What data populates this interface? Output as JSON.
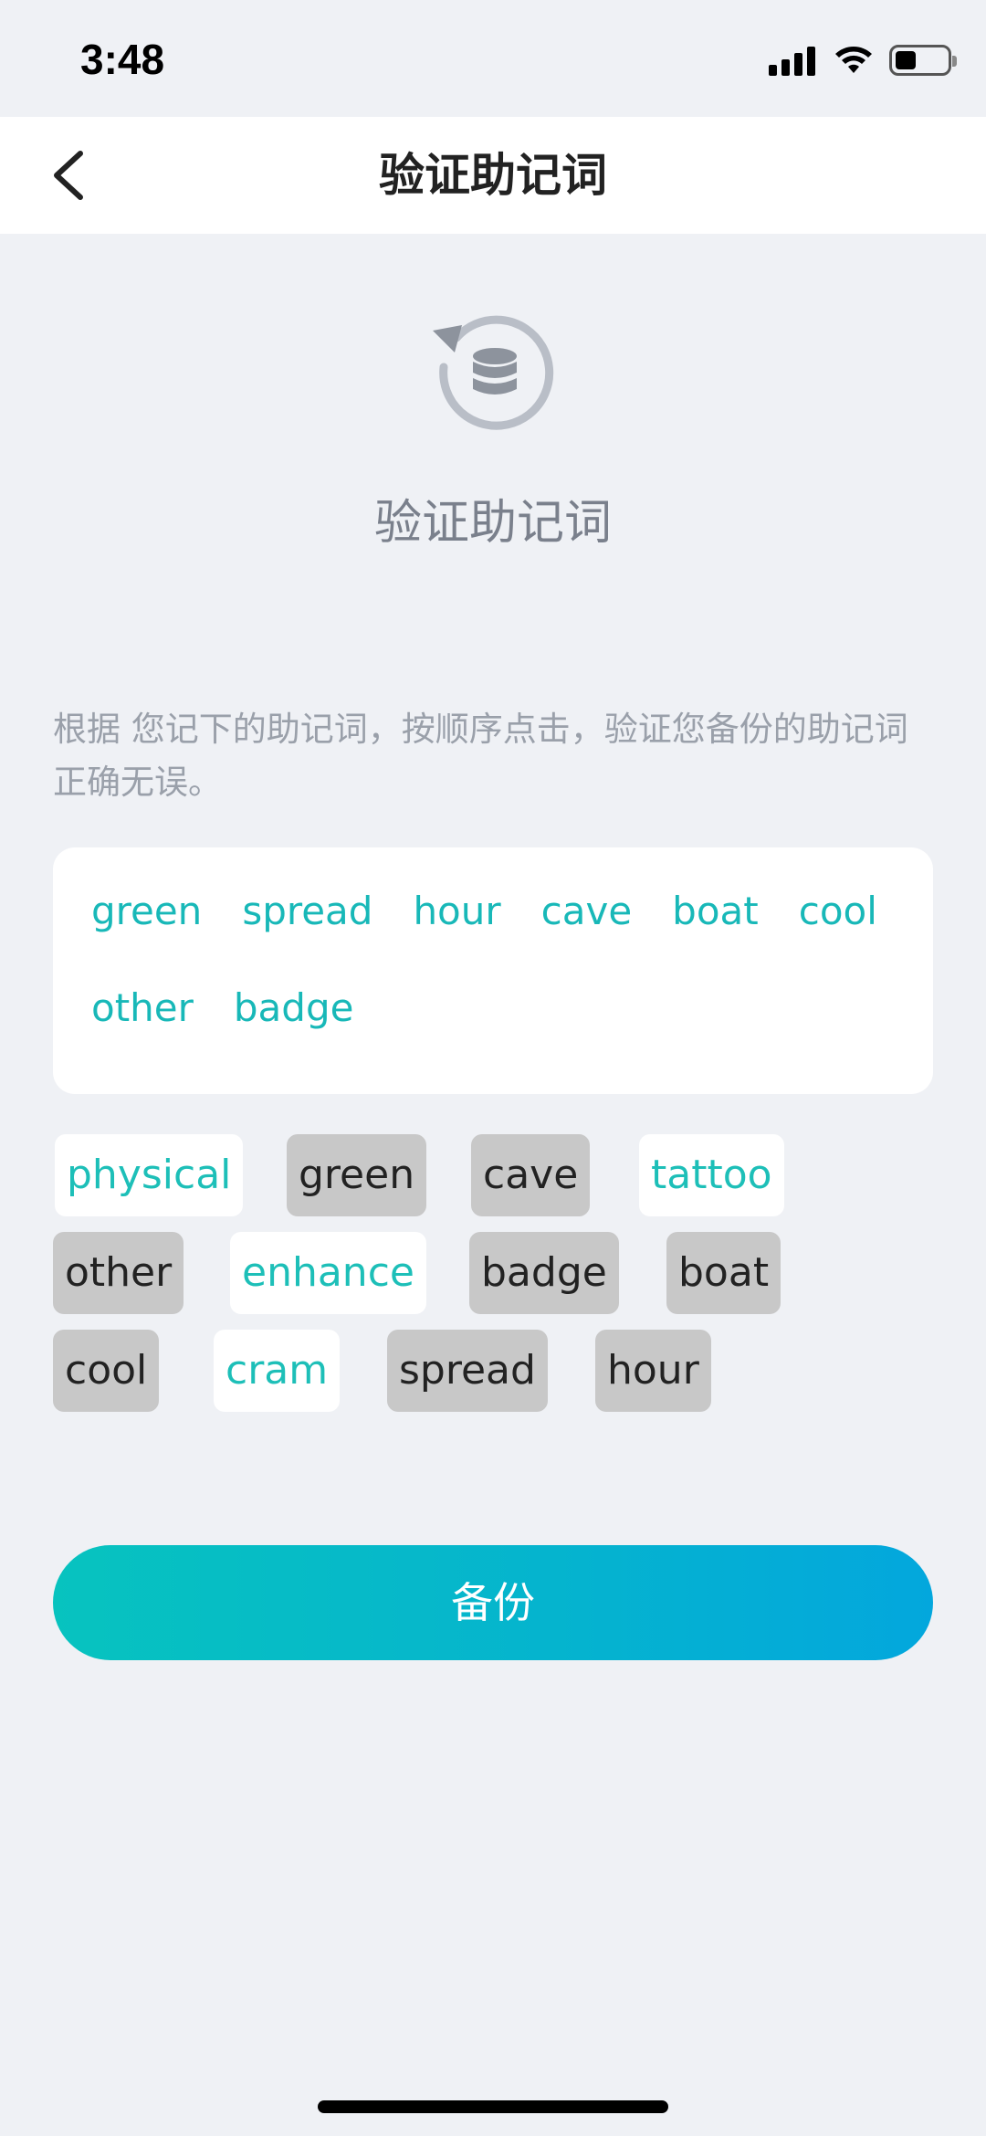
{
  "status_bar": {
    "time": "3:48"
  },
  "header": {
    "title": "验证助记词"
  },
  "hero": {
    "title": "验证助记词"
  },
  "instructions": "根据 您记下的助记词，按顺序点击，验证您备份的助记词正确无误。",
  "selected_words": [
    "green",
    "spread",
    "hour",
    "cave",
    "boat",
    "cool",
    "other",
    "badge"
  ],
  "word_pool": [
    {
      "word": "physical",
      "state": "available"
    },
    {
      "word": "green",
      "state": "selected"
    },
    {
      "word": "cave",
      "state": "selected"
    },
    {
      "word": "tattoo",
      "state": "available"
    },
    {
      "word": "other",
      "state": "selected"
    },
    {
      "word": "enhance",
      "state": "available"
    },
    {
      "word": "badge",
      "state": "selected"
    },
    {
      "word": "boat",
      "state": "selected"
    },
    {
      "word": "cool",
      "state": "selected"
    },
    {
      "word": "cram",
      "state": "available"
    },
    {
      "word": "spread",
      "state": "selected"
    },
    {
      "word": "hour",
      "state": "selected"
    }
  ],
  "backup_button": {
    "label": "备份"
  },
  "colors": {
    "accent": "#1dbfb8",
    "background": "#eff1f5",
    "chip_selected": "#c8c8c8"
  }
}
